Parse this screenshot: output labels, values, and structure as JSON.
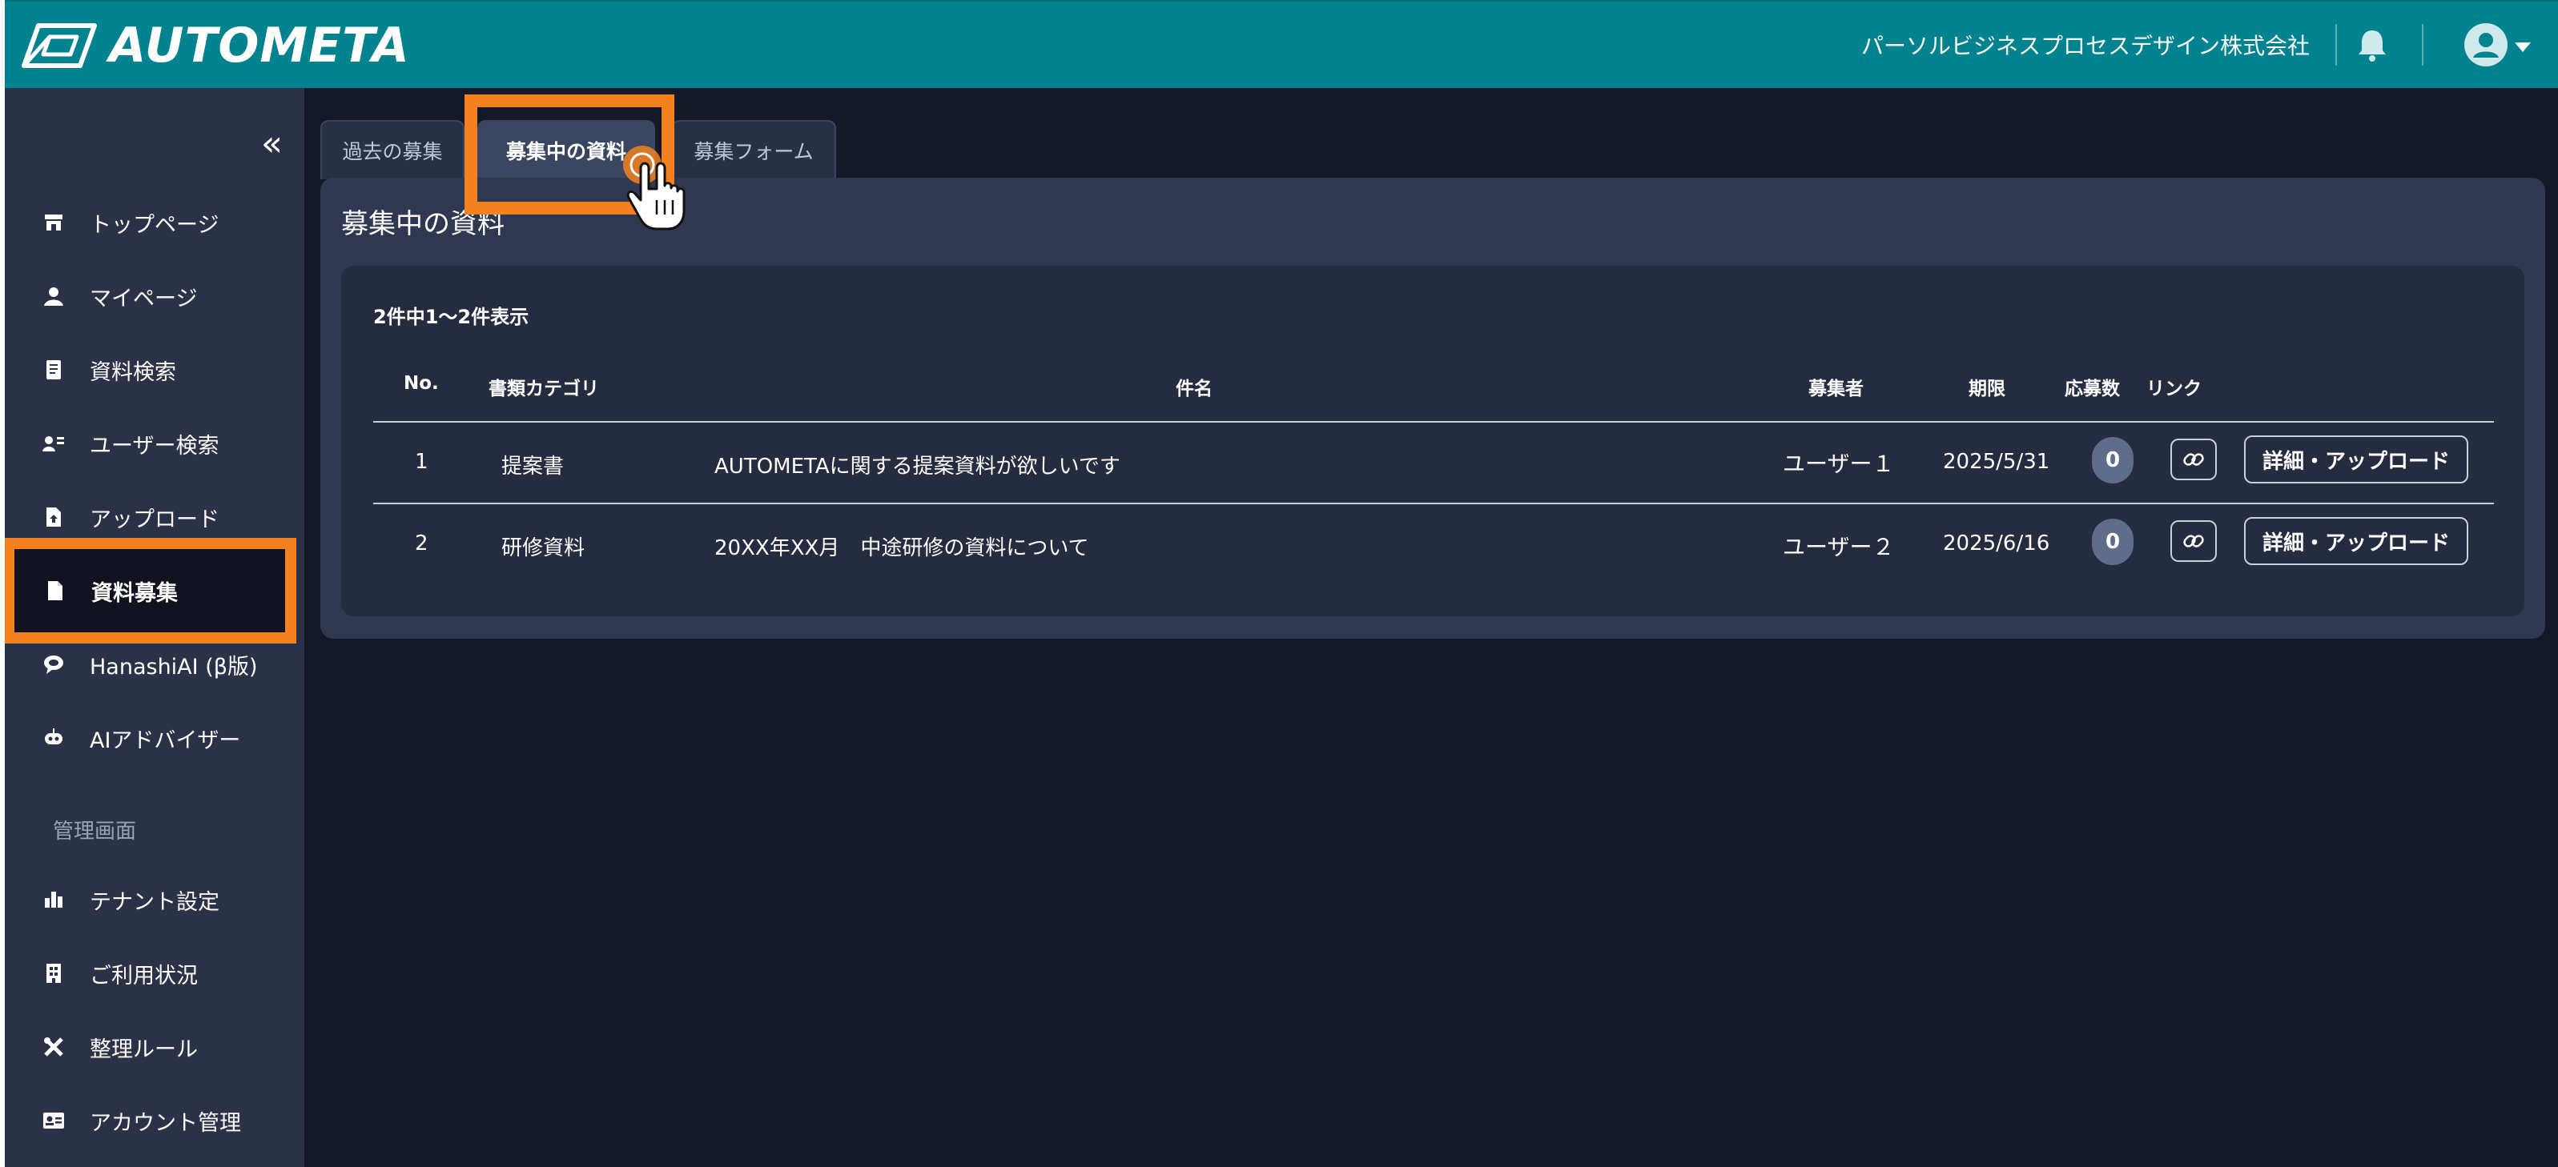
{
  "header": {
    "logo_text": "AUTOMETA",
    "company": "パーソルビジネスプロセスデザイン株式会社"
  },
  "sidebar": {
    "collapse_glyph": "«",
    "items": [
      {
        "label": "トップページ",
        "icon": "store-icon"
      },
      {
        "label": "マイページ",
        "icon": "person-icon"
      },
      {
        "label": "資料検索",
        "icon": "document-search-icon"
      },
      {
        "label": "ユーザー検索",
        "icon": "user-search-icon"
      },
      {
        "label": "アップロード",
        "icon": "file-upload-icon"
      },
      {
        "label": "資料募集",
        "icon": "file-icon",
        "active": true
      },
      {
        "label": "HanashiAI (β版)",
        "icon": "chat-bubble-icon"
      },
      {
        "label": "AIアドバイザー",
        "icon": "robot-icon"
      }
    ],
    "section_label": "管理画面",
    "admin_items": [
      {
        "label": "テナント設定",
        "icon": "tenant-icon"
      },
      {
        "label": "ご利用状況",
        "icon": "building-icon"
      },
      {
        "label": "整理ルール",
        "icon": "tools-icon"
      },
      {
        "label": "アカウント管理",
        "icon": "id-card-icon"
      }
    ]
  },
  "tabs": [
    {
      "label": "過去の募集",
      "active": false
    },
    {
      "label": "募集中の資料",
      "active": true
    },
    {
      "label": "募集フォーム",
      "active": false
    }
  ],
  "panel": {
    "title": "募集中の資料",
    "count_text": "2件中1〜2件表示",
    "columns": {
      "no": "No.",
      "category": "書類カテゴリ",
      "subject": "件名",
      "requester": "募集者",
      "deadline": "期限",
      "responses": "応募数",
      "link": "リンク"
    },
    "rows": [
      {
        "no": "1",
        "category": "提案書",
        "subject": "AUTOMETAに関する提案資料が欲しいです",
        "requester": "ユーザー１",
        "deadline": "2025/5/31",
        "responses": "0",
        "action": "詳細・アップロード"
      },
      {
        "no": "2",
        "category": "研修資料",
        "subject": "20XX年XX月　中途研修の資料について",
        "requester": "ユーザー２",
        "deadline": "2025/6/16",
        "responses": "0",
        "action": "詳細・アップロード"
      }
    ]
  },
  "colors": {
    "header_bg": "#00838f",
    "sidebar_bg": "#2b3248",
    "main_bg": "#131726",
    "highlight": "#f58220"
  }
}
